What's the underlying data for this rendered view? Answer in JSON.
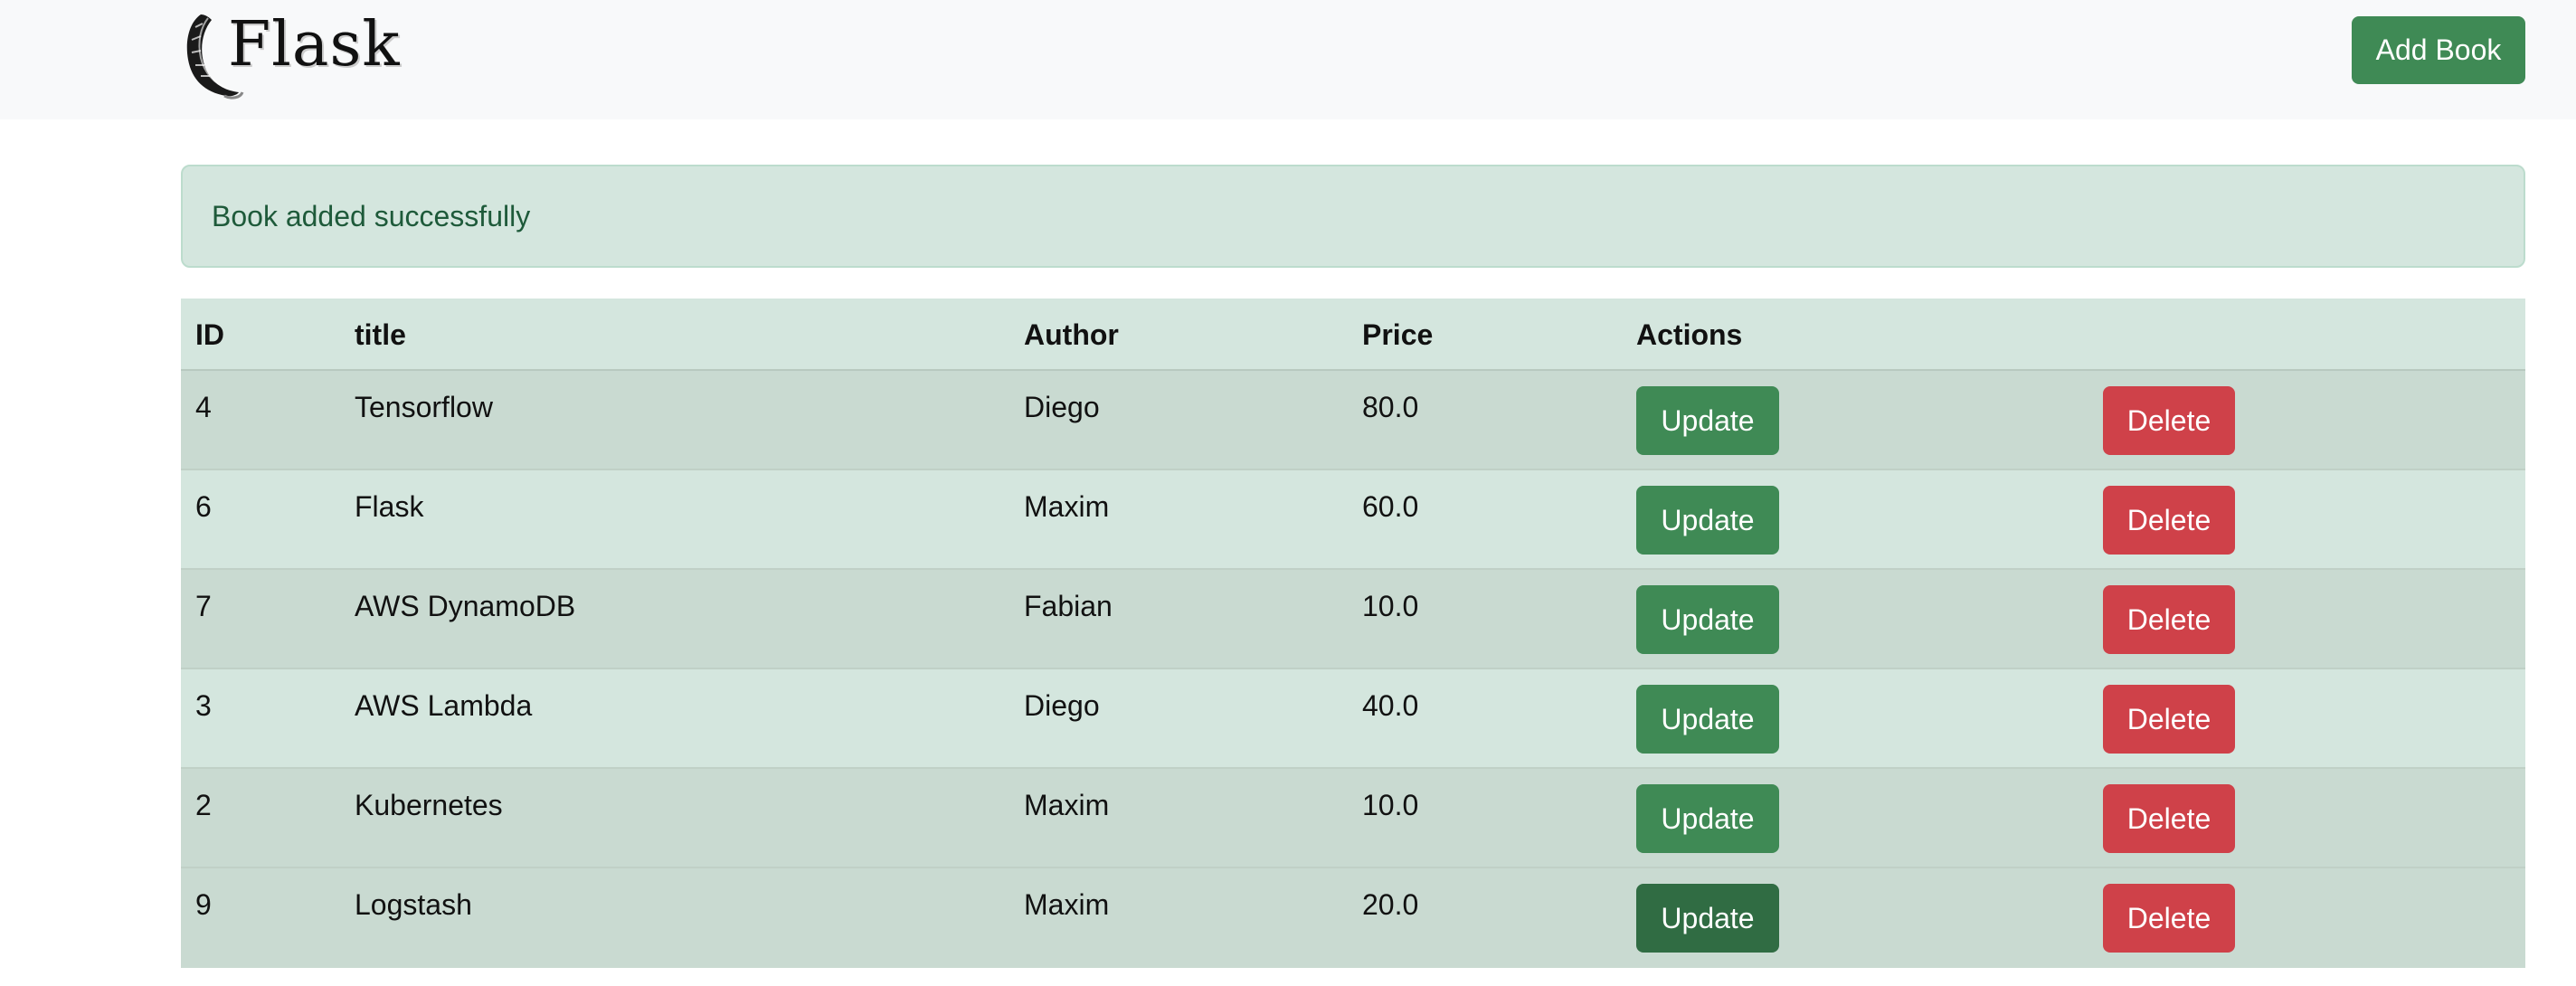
{
  "navbar": {
    "logo_text": "Flask",
    "add_book_label": "Add Book"
  },
  "alert": {
    "message": "Book added successfully"
  },
  "table": {
    "headers": {
      "id": "ID",
      "title": "title",
      "author": "Author",
      "price": "Price",
      "actions": "Actions"
    },
    "rows": [
      {
        "id": "4",
        "title": "Tensorflow",
        "author": "Diego",
        "price": "80.0",
        "update_label": "Update",
        "delete_label": "Delete"
      },
      {
        "id": "6",
        "title": "Flask",
        "author": "Maxim",
        "price": "60.0",
        "update_label": "Update",
        "delete_label": "Delete"
      },
      {
        "id": "7",
        "title": "AWS DynamoDB",
        "author": "Fabian",
        "price": "10.0",
        "update_label": "Update",
        "delete_label": "Delete"
      },
      {
        "id": "3",
        "title": "AWS Lambda",
        "author": "Diego",
        "price": "40.0",
        "update_label": "Update",
        "delete_label": "Delete"
      },
      {
        "id": "2",
        "title": "Kubernetes",
        "author": "Maxim",
        "price": "10.0",
        "update_label": "Update",
        "delete_label": "Delete"
      },
      {
        "id": "9",
        "title": "Logstash",
        "author": "Maxim",
        "price": "20.0",
        "update_label": "Update",
        "delete_label": "Delete"
      }
    ]
  },
  "colors": {
    "navbar_bg": "#f8f9fa",
    "success": "#3f8a55",
    "danger": "#cf4149",
    "alert_bg": "#d4e6de",
    "alert_text": "#1e5a3a"
  },
  "icons": {
    "logo": "flask-horn-logo-icon"
  }
}
